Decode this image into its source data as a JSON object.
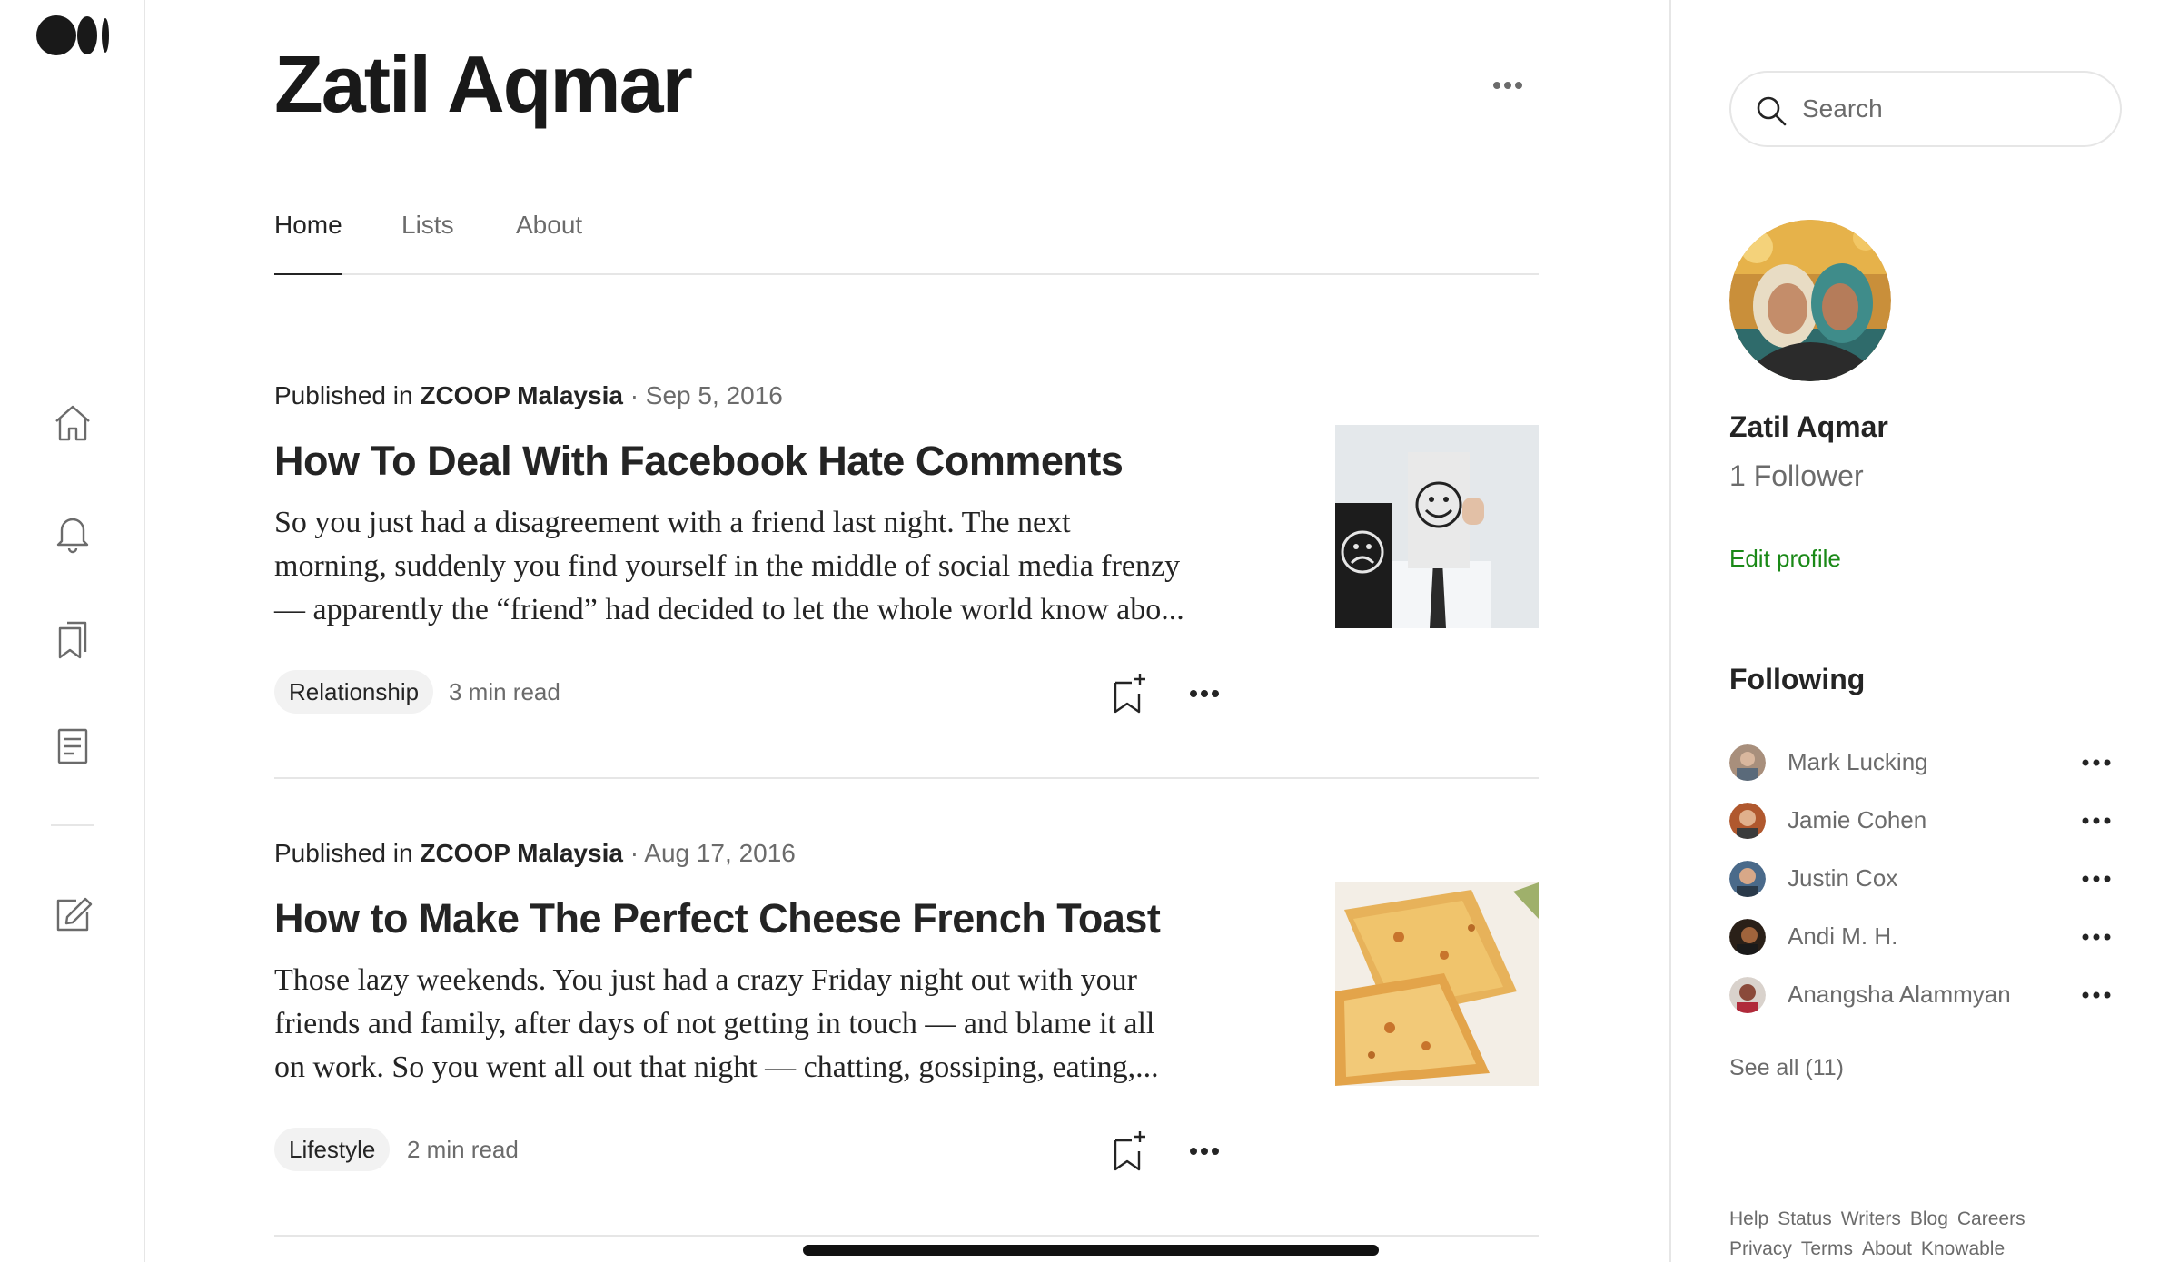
{
  "rail": {
    "logo_icon": "medium-logo",
    "items": [
      {
        "icon": "home-icon"
      },
      {
        "icon": "bell-icon"
      },
      {
        "icon": "bookmarks-icon"
      },
      {
        "icon": "stories-icon"
      },
      {
        "icon": "write-icon"
      }
    ]
  },
  "profile": {
    "title": "Zatil Aqmar",
    "tabs": [
      "Home",
      "Lists",
      "About"
    ],
    "active_tab": "Home"
  },
  "articles": [
    {
      "published_prefix": "Published in",
      "publication": "ZCOOP Malaysia",
      "date": "· Sep 5, 2016",
      "title": "How To Deal With Facebook Hate Comments",
      "snippet": [
        "So you just had a disagreement with a friend last night. The next",
        "morning, suddenly you find yourself in the middle of social media frenzy",
        "— apparently the “friend” had decided to let the whole world know abo..."
      ],
      "tag": "Relationship",
      "read_time": "3 min read"
    },
    {
      "published_prefix": "Published in",
      "publication": "ZCOOP Malaysia",
      "date": "· Aug 17, 2016",
      "title": "How to Make The Perfect Cheese French Toast",
      "snippet": [
        "Those lazy weekends. You just had a crazy Friday night out with your",
        "friends and family, after days of not getting in touch — and blame it all",
        "on work. So you went all out that night — chatting, gossiping, eating,..."
      ],
      "tag": "Lifestyle",
      "read_time": "2 min read"
    }
  ],
  "sidebar": {
    "search_placeholder": "Search",
    "name": "Zatil Aqmar",
    "followers": "1 Follower",
    "edit_profile": "Edit profile",
    "following_title": "Following",
    "following": [
      {
        "name": "Mark Lucking"
      },
      {
        "name": "Jamie Cohen"
      },
      {
        "name": "Justin Cox"
      },
      {
        "name": "Andi M. H."
      },
      {
        "name": "Anangsha Alammyan"
      }
    ],
    "see_all": "See all (11)",
    "footer_row1": [
      "Help",
      "Status",
      "Writers",
      "Blog",
      "Careers"
    ],
    "footer_row2": [
      "Privacy",
      "Terms",
      "About",
      "Knowable"
    ]
  },
  "colors": {
    "text": "#242424",
    "muted": "#6b6b6b",
    "accent_green": "#1a8917",
    "divider": "#e6e6e6"
  }
}
